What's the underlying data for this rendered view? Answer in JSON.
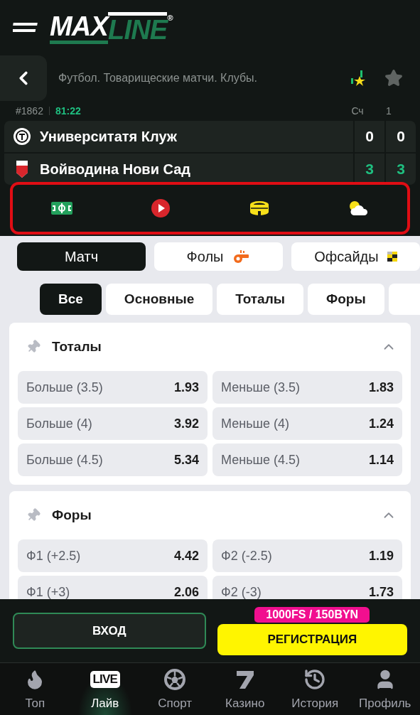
{
  "logo": {
    "part_1": "MAX",
    "part_2": "LINE",
    "mark": "®"
  },
  "match": {
    "title": "Футбол. Товарищеские матчи. Клубы.",
    "number": "#1862",
    "time": "81:22",
    "columns": [
      "Сч",
      "1"
    ],
    "favorite": false,
    "teams": [
      {
        "name": "Университатя Клуж",
        "scores": [
          "0",
          "0"
        ],
        "leading": false
      },
      {
        "name": "Войводина Нови Сад",
        "scores": [
          "3",
          "3"
        ],
        "leading": true
      }
    ],
    "highlighted_icons": true
  },
  "tabs": [
    {
      "label": "Матч",
      "selected": true
    },
    {
      "label": "Фолы",
      "selected": false
    },
    {
      "label": "Офсайды",
      "selected": false
    }
  ],
  "filters": [
    {
      "label": "Все",
      "selected": true
    },
    {
      "label": "Основные",
      "selected": false
    },
    {
      "label": "Тоталы",
      "selected": false
    },
    {
      "label": "Форы",
      "selected": false
    },
    {
      "selected": false
    }
  ],
  "markets": [
    {
      "title": "Тоталы",
      "expanded": true,
      "rows": [
        [
          {
            "name": "Больше (3.5)",
            "odds": "1.93"
          },
          {
            "name": "Меньше (3.5)",
            "odds": "1.83"
          }
        ],
        [
          {
            "name": "Больше (4)",
            "odds": "3.92"
          },
          {
            "name": "Меньше (4)",
            "odds": "1.24"
          }
        ],
        [
          {
            "name": "Больше (4.5)",
            "odds": "5.34"
          },
          {
            "name": "Меньше (4.5)",
            "odds": "1.14"
          }
        ]
      ]
    },
    {
      "title": "Форы",
      "expanded": true,
      "rows": [
        [
          {
            "name": "Ф1 (+2.5)",
            "odds": "4.42"
          },
          {
            "name": "Ф2 (-2.5)",
            "odds": "1.19"
          }
        ],
        [
          {
            "name": "Ф1 (+3)",
            "odds": "2.06"
          },
          {
            "name": "Ф2 (-3)",
            "odds": "1.73"
          }
        ]
      ]
    }
  ],
  "auth": {
    "login": "ВХОД",
    "register": "РЕГИСТРАЦИЯ",
    "bonus": "1000FS / 150BYN"
  },
  "nav": [
    {
      "label": "Топ",
      "selected": false
    },
    {
      "label": "Лайв",
      "icon_text": "LIVE",
      "selected": true
    },
    {
      "label": "Спорт",
      "selected": false
    },
    {
      "label": "Казино",
      "selected": false
    },
    {
      "label": "История",
      "selected": false
    },
    {
      "label": "Профиль",
      "selected": false
    }
  ]
}
